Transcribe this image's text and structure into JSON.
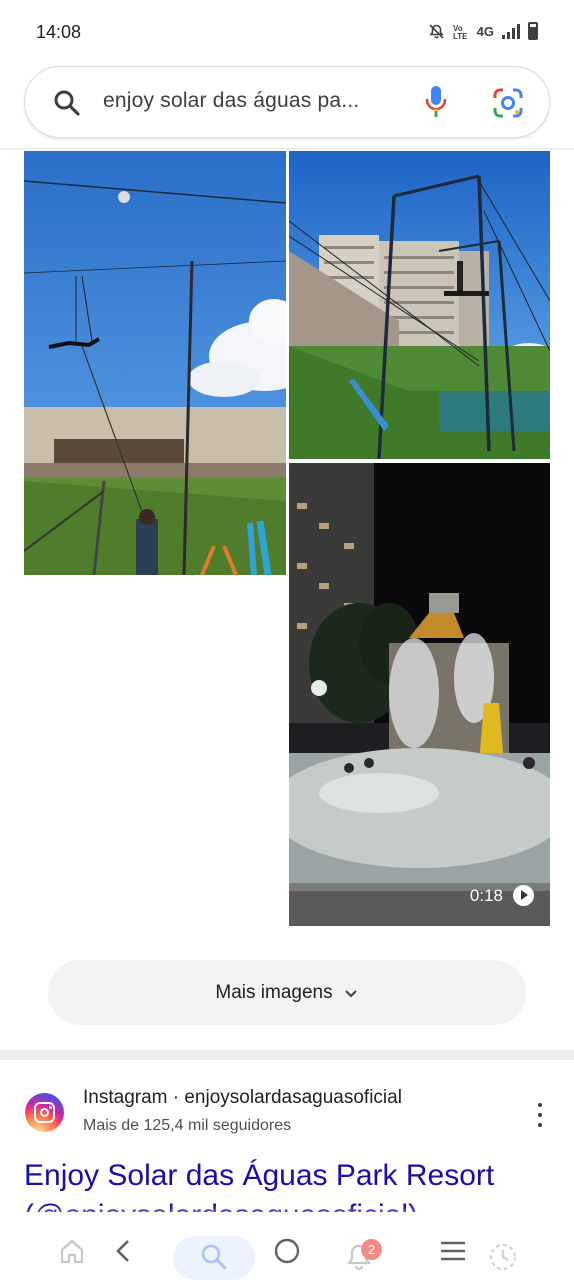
{
  "status_bar": {
    "time": "14:08",
    "network": "4G",
    "icons": [
      "mute-icon",
      "volte-icon",
      "signal-icon",
      "battery-icon"
    ]
  },
  "search": {
    "query": "enjoy solar das águas pa...",
    "icons": [
      "search-icon",
      "microphone-icon",
      "google-lens-icon"
    ]
  },
  "images": [
    {
      "type": "image",
      "subject": "trapeze rig outdoors under blue sky"
    },
    {
      "type": "image",
      "subject": "trapeze rig with buildings behind"
    },
    {
      "type": "video",
      "subject": "water park at night",
      "duration": "0:18"
    }
  ],
  "more_images": {
    "label": "Mais imagens"
  },
  "result": {
    "source": "Instagram · enjoysolardasaguasoficial",
    "followers": "Mais de 125,4 mil seguidores",
    "title": "Enjoy Solar das Águas Park Resort (@enjoysolardasaguasoficial)"
  },
  "bottom_nav": {
    "items": [
      "home-icon",
      "back-icon",
      "search-icon",
      "home-circle-icon",
      "notifications-icon",
      "menu-icon",
      "history-icon"
    ],
    "notification_count": "2"
  },
  "colors": {
    "link": "#1a0dab",
    "pill_bg": "#f1f3f4",
    "sky": "#2f7fd8",
    "grass": "#5e8f35"
  }
}
